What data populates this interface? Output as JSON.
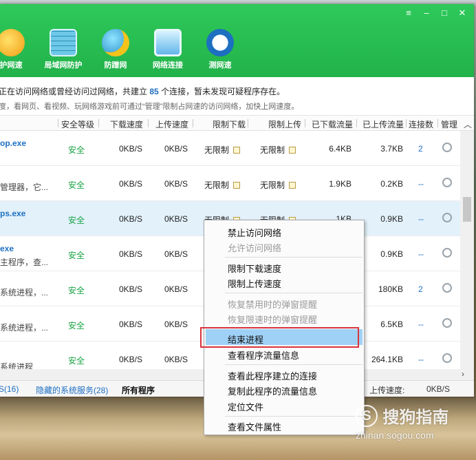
{
  "window": {
    "controls": {
      "menu": "≡",
      "minimize": "–",
      "maximize": "□",
      "close": "✕"
    }
  },
  "toolbar": {
    "items": [
      {
        "label": "护网速",
        "icon": "shield-lightning-icon"
      },
      {
        "label": "局域网防护",
        "icon": "firewall-wall-icon"
      },
      {
        "label": "防蹭网",
        "icon": "globe-shield-icon"
      },
      {
        "label": "网络连接",
        "icon": "network-monitor-icon"
      },
      {
        "label": "测网速",
        "icon": "speedometer-icon"
      }
    ]
  },
  "info": {
    "line1_prefix": "正在访问网络或曾经访问过网络，共建立",
    "line1_count": "85",
    "line1_suffix": "个连接，暂未发现可疑程序存在。",
    "line2": "度，看网页、看视频、玩网络游戏前可通过“管理”限制占网速的访问网络，加快上网速度。"
  },
  "table": {
    "headers": [
      "安全等级",
      "下载速度",
      "上传速度",
      "限制下载",
      "限制上传",
      "已下载流量",
      "已上传流量",
      "连接数",
      "管理"
    ],
    "rows": [
      {
        "name": "op.exe",
        "desc": "",
        "safety": "安全",
        "down": "0KB/S",
        "up": "0KB/S",
        "limit_down": "无限制",
        "limit_up": "无限制",
        "downloaded": "6.4KB",
        "uploaded": "3.7KB",
        "conns": "2"
      },
      {
        "name": "",
        "desc": "管理器，它...",
        "safety": "安全",
        "down": "0KB/S",
        "up": "0KB/S",
        "limit_down": "无限制",
        "limit_up": "无限制",
        "downloaded": "1.9KB",
        "uploaded": "0.2KB",
        "conns": "--"
      },
      {
        "name": "ps.exe",
        "desc": "",
        "safety": "安全",
        "down": "0KB/S",
        "up": "0KB/S",
        "limit_down": "无限制",
        "limit_up": "无限制",
        "downloaded": "1KB",
        "uploaded": "0.9KB",
        "conns": "--"
      },
      {
        "name": "exe",
        "desc": "主程序，查...",
        "safety": "安全",
        "down": "0KB/S",
        "up": "0KB/S",
        "limit_down": "",
        "limit_up": "",
        "downloaded": "",
        "uploaded": "0.9KB",
        "conns": "--"
      },
      {
        "name": "",
        "desc": "系统进程，...",
        "safety": "安全",
        "down": "0KB/S",
        "up": "0KB/S",
        "limit_down": "",
        "limit_up": "",
        "downloaded": "",
        "uploaded": "180KB",
        "conns": "2"
      },
      {
        "name": "",
        "desc": "系统进程，...",
        "safety": "安全",
        "down": "0KB/S",
        "up": "0KB/S",
        "limit_down": "",
        "limit_up": "",
        "downloaded": "",
        "uploaded": "6.5KB",
        "conns": "--"
      },
      {
        "name": "",
        "desc": "系统进程",
        "safety": "安全",
        "down": "0KB/S",
        "up": "0KB/S",
        "limit_down": "",
        "limit_up": "",
        "downloaded": "",
        "uploaded": "264.1KB",
        "conns": "--"
      }
    ]
  },
  "statusbar": {
    "tab1": "S(16)",
    "tab2": "隐藏的系统服务(28)",
    "tab3": "所有程序",
    "upload_label": "上传速度:",
    "upload_value": "0KB/S"
  },
  "context_menu": {
    "items": [
      {
        "label": "禁止访问网络",
        "disabled": false
      },
      {
        "label": "允许访问网络",
        "disabled": true
      },
      {
        "label": "限制下载速度",
        "disabled": false
      },
      {
        "label": "限制上传速度",
        "disabled": false
      },
      {
        "label": "恢复禁用时的弹窗提醒",
        "disabled": true
      },
      {
        "label": "恢复限速时的弹窗提醒",
        "disabled": true
      },
      {
        "label": "结束进程",
        "disabled": false,
        "highlighted": true
      },
      {
        "label": "查看程序流量信息",
        "disabled": false
      },
      {
        "label": "查看此程序建立的连接",
        "disabled": false
      },
      {
        "label": "复制此程序的流量信息",
        "disabled": false
      },
      {
        "label": "定位文件",
        "disabled": false
      },
      {
        "label": "查看文件属性",
        "disabled": false
      }
    ]
  },
  "watermark": {
    "logo": "S",
    "brand": "搜狗指南",
    "url": "zhinan.sogou.com"
  },
  "colors": {
    "titlebar": "#22b24a",
    "link": "#1e6fc2",
    "safe": "#19a345",
    "menu_highlight": "#9fd1f6",
    "annotation_box": "#d8333b"
  }
}
